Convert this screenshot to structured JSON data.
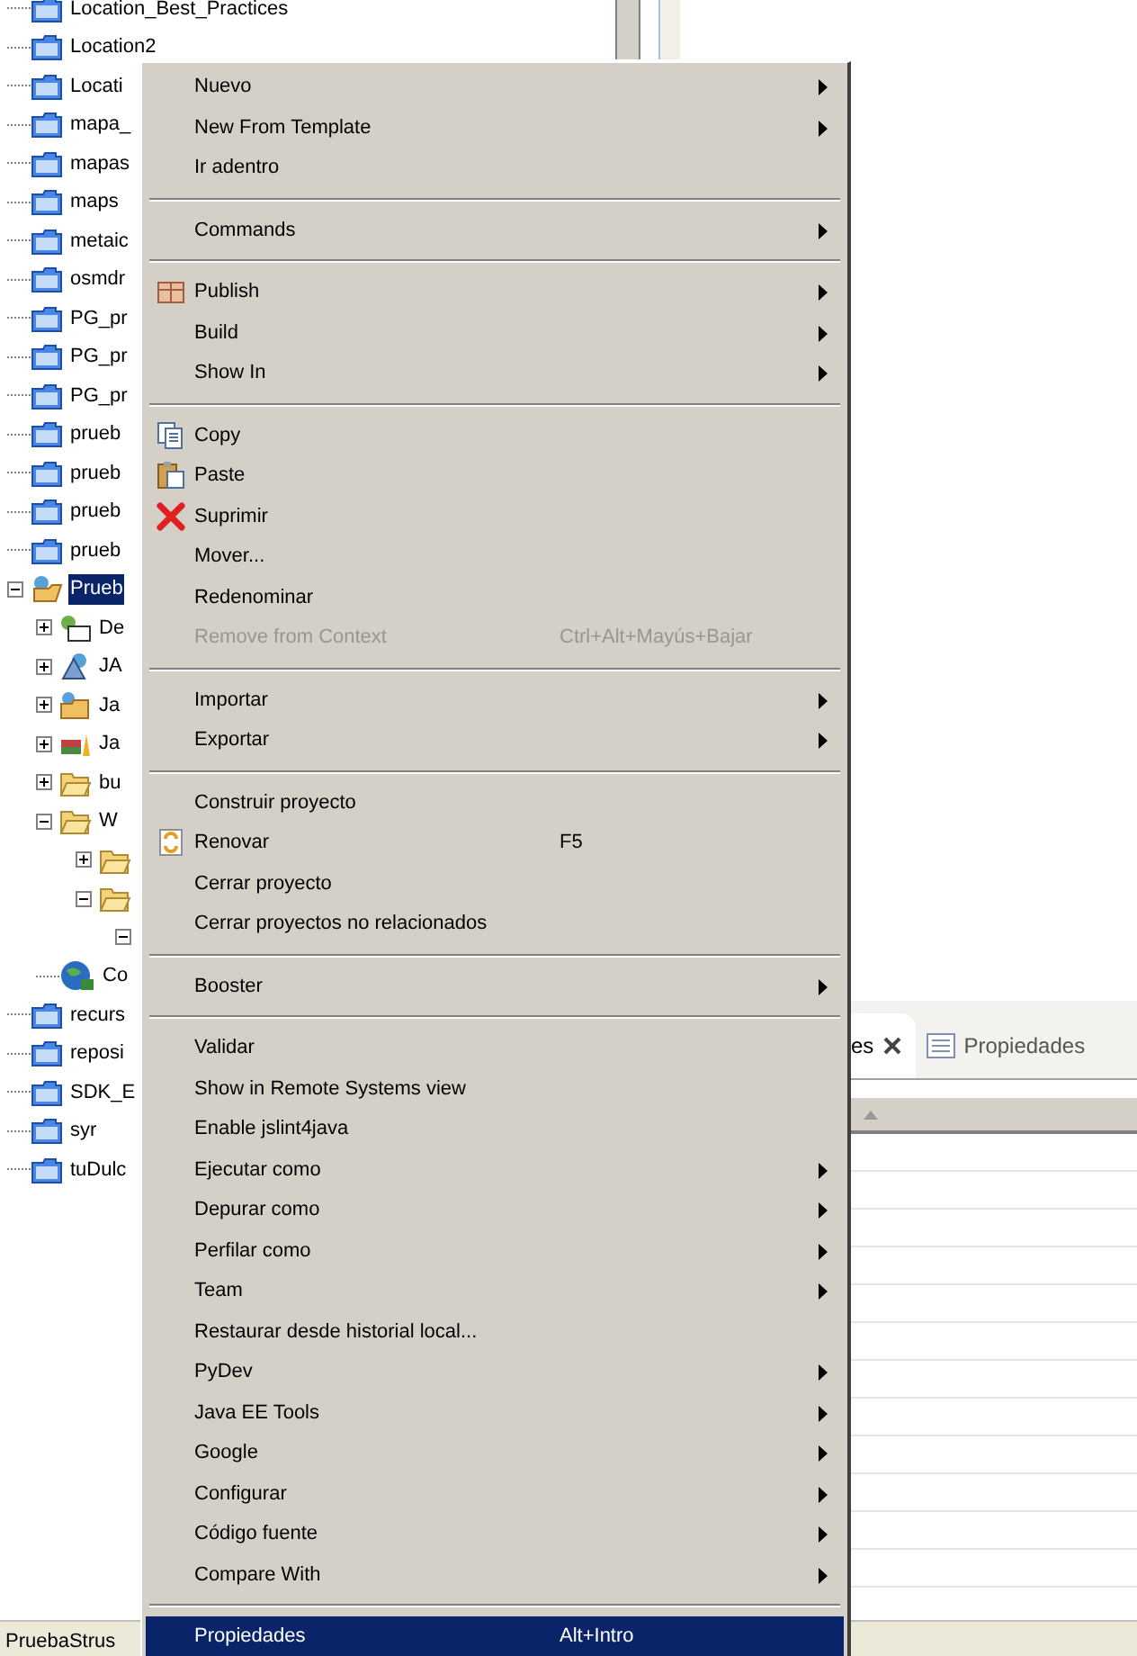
{
  "tree": [
    {
      "label": "Location_Best_Practices",
      "kind": "project"
    },
    {
      "label": "Location2",
      "kind": "project"
    },
    {
      "label": "Locati",
      "kind": "project"
    },
    {
      "label": "mapa_",
      "kind": "project"
    },
    {
      "label": "mapas",
      "kind": "project"
    },
    {
      "label": "maps",
      "kind": "project"
    },
    {
      "label": "metaic",
      "kind": "project"
    },
    {
      "label": "osmdr",
      "kind": "project"
    },
    {
      "label": "PG_pr",
      "kind": "project"
    },
    {
      "label": "PG_pr",
      "kind": "project"
    },
    {
      "label": "PG_pr",
      "kind": "project"
    },
    {
      "label": "prueb",
      "kind": "project"
    },
    {
      "label": "prueb",
      "kind": "project"
    },
    {
      "label": "prueb",
      "kind": "project"
    },
    {
      "label": "prueb",
      "kind": "project"
    },
    {
      "label": "Prueb",
      "kind": "web-project",
      "selected": true,
      "expanded": true,
      "children": [
        {
          "label": "De",
          "kind": "descriptor",
          "expanded": false
        },
        {
          "label": "JA",
          "kind": "jax",
          "expanded": false
        },
        {
          "label": "Ja",
          "kind": "java-resources",
          "expanded": false
        },
        {
          "label": "Ja",
          "kind": "libraries",
          "expanded": false
        },
        {
          "label": "bu",
          "kind": "folder",
          "expanded": false
        },
        {
          "label": "W",
          "kind": "folder",
          "expanded": true,
          "children": [
            {
              "kind": "folder",
              "expanded": false
            },
            {
              "kind": "folder",
              "expanded": true,
              "children": [
                {
                  "expanded": true
                }
              ]
            }
          ]
        },
        {
          "label": "Co",
          "kind": "globe"
        }
      ]
    },
    {
      "label": "recurs",
      "kind": "project"
    },
    {
      "label": "reposi",
      "kind": "project"
    },
    {
      "label": "SDK_E",
      "kind": "project"
    },
    {
      "label": "syr",
      "kind": "project"
    },
    {
      "label": "tuDulc",
      "kind": "project"
    }
  ],
  "context_menu": {
    "groups": [
      [
        {
          "label": "Nuevo",
          "submenu": true,
          "disabled": false,
          "selected": false
        },
        {
          "label": "New From Template",
          "submenu": true,
          "disabled": false,
          "selected": false
        },
        {
          "label": "Ir adentro",
          "submenu": false,
          "disabled": false,
          "selected": false
        }
      ],
      [
        {
          "label": "Commands",
          "submenu": true,
          "disabled": false,
          "selected": false
        }
      ],
      [
        {
          "label": "Publish",
          "kind": "publish",
          "submenu": true,
          "disabled": false,
          "selected": false
        },
        {
          "label": "Build",
          "submenu": true,
          "disabled": false,
          "selected": false
        },
        {
          "label": "Show In",
          "submenu": true,
          "disabled": false,
          "selected": false
        }
      ],
      [
        {
          "label": "Copy",
          "kind": "copy",
          "submenu": false,
          "disabled": false,
          "selected": false
        },
        {
          "label": "Paste",
          "kind": "paste",
          "submenu": false,
          "disabled": false,
          "selected": false
        },
        {
          "label": "Suprimir",
          "kind": "delete",
          "submenu": false,
          "disabled": false,
          "selected": false
        },
        {
          "label": "Mover...",
          "submenu": false,
          "disabled": false,
          "selected": false
        },
        {
          "label": "Redenominar",
          "submenu": false,
          "disabled": false,
          "selected": false
        },
        {
          "label": "Remove from Context",
          "shortcut": "Ctrl+Alt+Mayús+Bajar",
          "submenu": false,
          "disabled": true,
          "selected": false
        }
      ],
      [
        {
          "label": "Importar",
          "submenu": true,
          "disabled": false,
          "selected": false
        },
        {
          "label": "Exportar",
          "submenu": true,
          "disabled": false,
          "selected": false
        }
      ],
      [
        {
          "label": "Construir proyecto",
          "submenu": false,
          "disabled": false,
          "selected": false
        },
        {
          "label": "Renovar",
          "kind": "refresh",
          "shortcut": "F5",
          "submenu": false,
          "disabled": false,
          "selected": false
        },
        {
          "label": "Cerrar proyecto",
          "submenu": false,
          "disabled": false,
          "selected": false
        },
        {
          "label": "Cerrar proyectos no relacionados",
          "submenu": false,
          "disabled": false,
          "selected": false
        }
      ],
      [
        {
          "label": "Booster",
          "submenu": true,
          "disabled": false,
          "selected": false
        }
      ],
      [
        {
          "label": "Validar",
          "submenu": false,
          "disabled": false,
          "selected": false
        },
        {
          "label": "Show in Remote Systems view",
          "submenu": false,
          "disabled": false,
          "selected": false
        },
        {
          "label": "Enable jslint4java",
          "submenu": false,
          "disabled": false,
          "selected": false
        },
        {
          "label": "Ejecutar como",
          "submenu": true,
          "disabled": false,
          "selected": false
        },
        {
          "label": "Depurar como",
          "submenu": true,
          "disabled": false,
          "selected": false
        },
        {
          "label": "Perfilar como",
          "submenu": true,
          "disabled": false,
          "selected": false
        },
        {
          "label": "Team",
          "submenu": true,
          "disabled": false,
          "selected": false
        },
        {
          "label": "Restaurar desde historial local...",
          "submenu": false,
          "disabled": false,
          "selected": false
        },
        {
          "label": "PyDev",
          "submenu": true,
          "disabled": false,
          "selected": false
        },
        {
          "label": "Java EE Tools",
          "submenu": true,
          "disabled": false,
          "selected": false
        },
        {
          "label": "Google",
          "submenu": true,
          "disabled": false,
          "selected": false
        },
        {
          "label": "Configurar",
          "submenu": true,
          "disabled": false,
          "selected": false
        },
        {
          "label": "Código fuente",
          "submenu": true,
          "disabled": false,
          "selected": false
        },
        {
          "label": "Compare With",
          "submenu": true,
          "disabled": false,
          "selected": false
        }
      ],
      [
        {
          "label": "Propiedades",
          "shortcut": "Alt+Intro",
          "submenu": false,
          "disabled": false,
          "selected": true
        }
      ]
    ]
  },
  "bottom_panel": {
    "tabs": [
      {
        "label": "es",
        "selected": true,
        "closable": true
      },
      {
        "label": "Propiedades",
        "selected": false,
        "closable": false
      }
    ]
  },
  "status_bar": {
    "text": "PruebaStrus"
  }
}
